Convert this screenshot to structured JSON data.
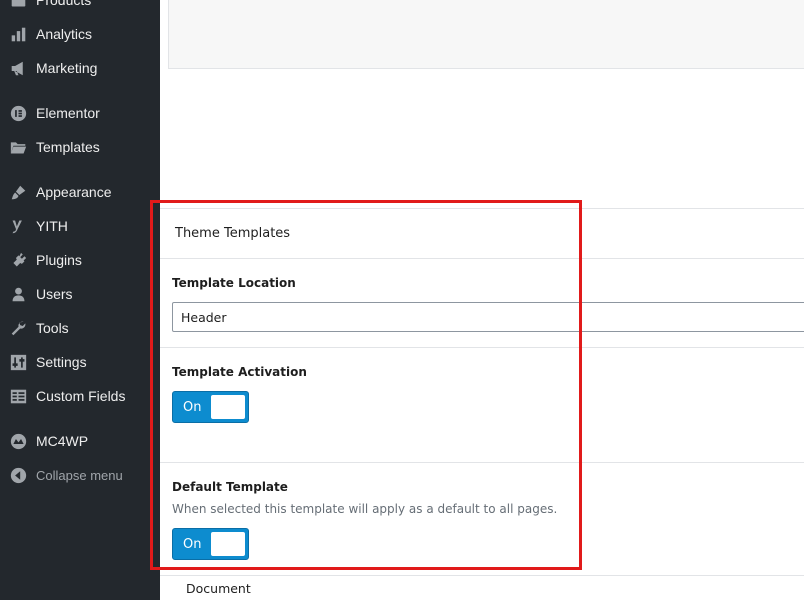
{
  "sidebar": {
    "items": [
      {
        "label": "Products",
        "icon": "products-icon"
      },
      {
        "label": "Analytics",
        "icon": "analytics-icon"
      },
      {
        "label": "Marketing",
        "icon": "megaphone-icon"
      },
      {
        "label": "Elementor",
        "icon": "elementor-icon"
      },
      {
        "label": "Templates",
        "icon": "folder-icon"
      },
      {
        "label": "Appearance",
        "icon": "paintbrush-icon"
      },
      {
        "label": "YITH",
        "icon": "yith-icon"
      },
      {
        "label": "Plugins",
        "icon": "plug-icon"
      },
      {
        "label": "Users",
        "icon": "user-icon"
      },
      {
        "label": "Tools",
        "icon": "wrench-icon"
      },
      {
        "label": "Settings",
        "icon": "sliders-icon"
      },
      {
        "label": "Custom Fields",
        "icon": "grid-icon"
      },
      {
        "label": "MC4WP",
        "icon": "mc4wp-icon"
      }
    ],
    "collapse_label": "Collapse menu",
    "collapse_icon": "collapse-arrow-icon",
    "colors": {
      "background": "#23282d",
      "text": "#eeeeee",
      "icon": "#a0a5aa"
    }
  },
  "panel": {
    "title": "Theme Templates",
    "location_label": "Template Location",
    "location_value": "Header",
    "activation_label": "Template Activation",
    "activation_toggle": "On",
    "default_label": "Default Template",
    "default_help": "When selected this template will apply as a default to all pages.",
    "default_toggle": "On",
    "document_label": "Document"
  },
  "colors": {
    "toggle_on": "#0d8ccf",
    "highlight": "#e11a1a"
  }
}
